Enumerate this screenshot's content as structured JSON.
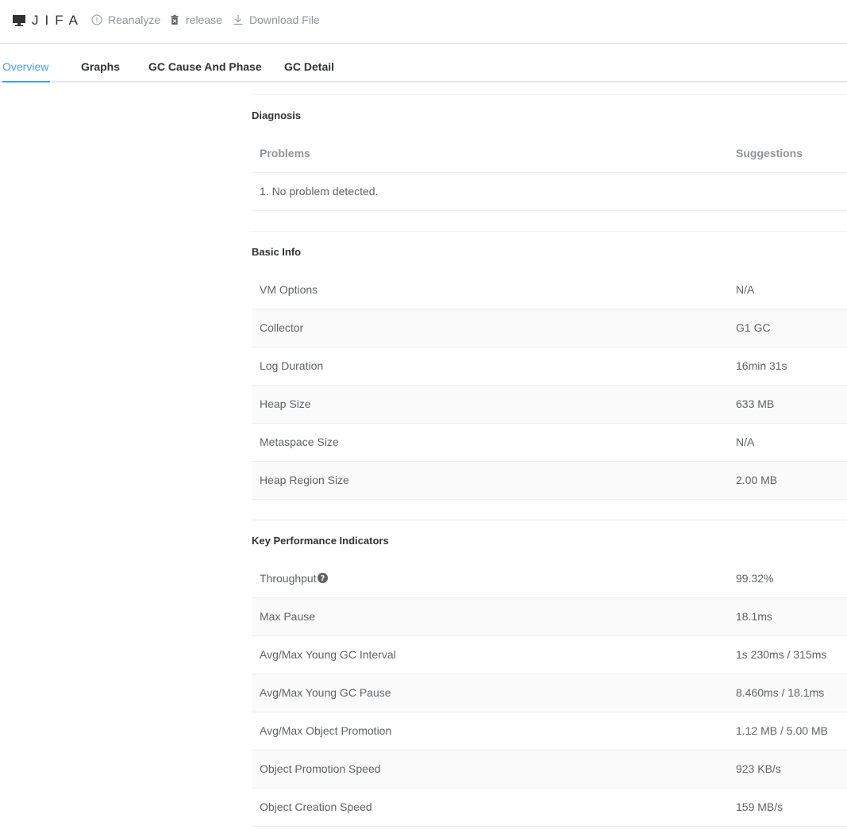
{
  "header": {
    "logo_text": "JIFA",
    "actions": {
      "reanalyze": "Reanalyze",
      "release": "release",
      "download": "Download File"
    }
  },
  "tabs": {
    "overview": "Overview",
    "graphs": "Graphs",
    "gc_cause_phase": "GC Cause And Phase",
    "gc_detail": "GC Detail",
    "active": "Overview"
  },
  "diagnosis": {
    "title": "Diagnosis",
    "columns": {
      "problems": "Problems",
      "suggestions": "Suggestions"
    },
    "rows": [
      {
        "problem": "1. No problem detected.",
        "suggestion": ""
      }
    ]
  },
  "basic_info": {
    "title": "Basic Info",
    "rows": [
      {
        "label": "VM Options",
        "value": "N/A"
      },
      {
        "label": "Collector",
        "value": "G1 GC"
      },
      {
        "label": "Log Duration",
        "value": "16min 31s"
      },
      {
        "label": "Heap Size",
        "value": "633 MB"
      },
      {
        "label": "Metaspace Size",
        "value": "N/A"
      },
      {
        "label": "Heap Region Size",
        "value": "2.00 MB"
      }
    ]
  },
  "kpi": {
    "title": "Key Performance Indicators",
    "rows": [
      {
        "label": "Throughput",
        "value": "99.32%"
      },
      {
        "label": "Max Pause",
        "value": "18.1ms"
      },
      {
        "label": "Avg/Max Young GC Interval",
        "value": "1s 230ms / 315ms"
      },
      {
        "label": "Avg/Max Young GC Pause",
        "value": "8.460ms / 18.1ms"
      },
      {
        "label": "Avg/Max Object Promotion",
        "value": "1.12 MB / 5.00 MB"
      },
      {
        "label": "Object Promotion Speed",
        "value": "923 KB/s"
      },
      {
        "label": "Object Creation Speed",
        "value": "159 MB/s"
      }
    ]
  },
  "colors": {
    "accent": "#409eff",
    "text_primary": "#303133",
    "text_regular": "#606266",
    "text_secondary": "#909399",
    "border": "#ebeef5",
    "row_alt": "#fafafa"
  },
  "icons": {
    "logo": "monitor-icon",
    "reanalyze": "info-circle-icon",
    "release": "trash-icon",
    "download": "download-icon",
    "throughput_help": "question-circle-icon"
  }
}
